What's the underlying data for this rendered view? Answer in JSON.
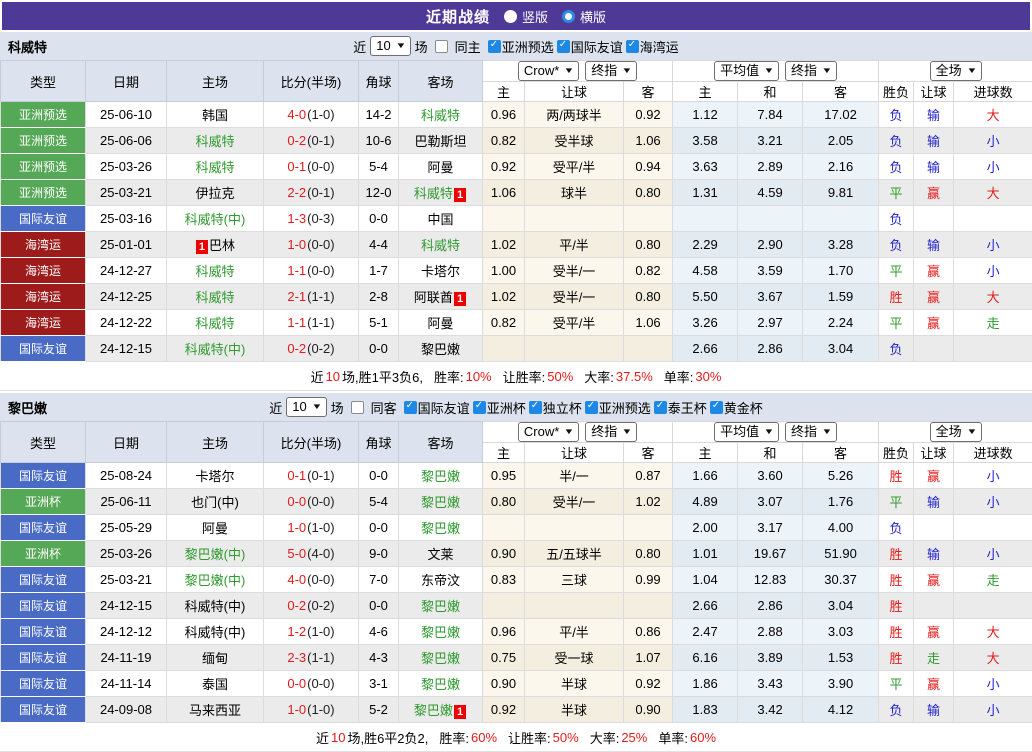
{
  "titlebar": {
    "title": "近期战绩",
    "vertical": "竖版",
    "horizontal": "横版"
  },
  "misc": {
    "badge": "1"
  },
  "table_header": {
    "cols": [
      "类型",
      "日期",
      "主场",
      "比分(半场)",
      "角球",
      "客场"
    ],
    "sub": [
      "主",
      "让球",
      "客",
      "主",
      "和",
      "客",
      "胜负",
      "让球",
      "进球数"
    ],
    "sel_odds1": "Crow*",
    "sel_odds2": "终指",
    "sel_avg1": "平均值",
    "sel_avg2": "终指",
    "sel_scope": "全场"
  },
  "sections": [
    {
      "team": "科威特",
      "filter": {
        "near": "近",
        "count": "10",
        "games": "场",
        "same": "同主",
        "leagues": [
          "亚洲预选",
          "国际友谊",
          "海湾运"
        ]
      },
      "rows": [
        {
          "t": "亚洲预选",
          "tc": "g",
          "d": "25-06-10",
          "h": "韩国",
          "hh": 0,
          "s": "4-0",
          "sh": "(1-0)",
          "c": "14-2",
          "a": "科威特",
          "ah": 1,
          "o1": "0.96",
          "hd": "两/两球半",
          "o2": "0.92",
          "m1": "1.12",
          "m2": "7.84",
          "m3": "17.02",
          "r1": "负",
          "c1": "b",
          "r2": "输",
          "c2": "b",
          "r3": "大",
          "c3": "r"
        },
        {
          "t": "亚洲预选",
          "tc": "g",
          "d": "25-06-06",
          "h": "科威特",
          "hh": 1,
          "s": "0-2",
          "sh": "(0-1)",
          "c": "10-6",
          "a": "巴勒斯坦",
          "ah": 0,
          "o1": "0.82",
          "hd": "受半球",
          "o2": "1.06",
          "m1": "3.58",
          "m2": "3.21",
          "m3": "2.05",
          "r1": "负",
          "c1": "b",
          "r2": "输",
          "c2": "b",
          "r3": "小",
          "c3": "b"
        },
        {
          "t": "亚洲预选",
          "tc": "g",
          "d": "25-03-26",
          "h": "科威特",
          "hh": 1,
          "s": "0-1",
          "sh": "(0-0)",
          "c": "5-4",
          "a": "阿曼",
          "ah": 0,
          "o1": "0.92",
          "hd": "受平/半",
          "o2": "0.94",
          "m1": "3.63",
          "m2": "2.89",
          "m3": "2.16",
          "r1": "负",
          "c1": "b",
          "r2": "输",
          "c2": "b",
          "r3": "小",
          "c3": "b"
        },
        {
          "t": "亚洲预选",
          "tc": "g",
          "d": "25-03-21",
          "h": "伊拉克",
          "hh": 0,
          "s": "2-2",
          "sh": "(0-1)",
          "c": "12-0",
          "a": "科威特",
          "ah": 1,
          "ab": "post",
          "o1": "1.06",
          "hd": "球半",
          "o2": "0.80",
          "m1": "1.31",
          "m2": "4.59",
          "m3": "9.81",
          "r1": "平",
          "c1": "g",
          "r2": "赢",
          "c2": "r",
          "r3": "大",
          "c3": "r"
        },
        {
          "t": "国际友谊",
          "tc": "b",
          "d": "25-03-16",
          "h": "科威特(中)",
          "hh": 1,
          "s": "1-3",
          "sh": "(0-3)",
          "c": "0-0",
          "a": "中国",
          "ah": 0,
          "o1": "",
          "hd": "",
          "o2": "",
          "m1": "",
          "m2": "",
          "m3": "",
          "r1": "负",
          "c1": "b",
          "r2": "",
          "r3": ""
        },
        {
          "t": "海湾运",
          "tc": "r",
          "d": "25-01-01",
          "h": "巴林",
          "hh": 0,
          "hb": "pre",
          "s": "1-0",
          "sh": "(0-0)",
          "c": "4-4",
          "a": "科威特",
          "ah": 1,
          "o1": "1.02",
          "hd": "平/半",
          "o2": "0.80",
          "m1": "2.29",
          "m2": "2.90",
          "m3": "3.28",
          "r1": "负",
          "c1": "b",
          "r2": "输",
          "c2": "b",
          "r3": "小",
          "c3": "b"
        },
        {
          "t": "海湾运",
          "tc": "r",
          "d": "24-12-27",
          "h": "科威特",
          "hh": 1,
          "s": "1-1",
          "sh": "(0-0)",
          "c": "1-7",
          "a": "卡塔尔",
          "ah": 0,
          "o1": "1.00",
          "hd": "受半/一",
          "o2": "0.82",
          "m1": "4.58",
          "m2": "3.59",
          "m3": "1.70",
          "r1": "平",
          "c1": "g",
          "r2": "赢",
          "c2": "r",
          "r3": "小",
          "c3": "b"
        },
        {
          "t": "海湾运",
          "tc": "r",
          "d": "24-12-25",
          "h": "科威特",
          "hh": 1,
          "s": "2-1",
          "sh": "(1-1)",
          "c": "2-8",
          "a": "阿联酋",
          "ah": 0,
          "ab": "post",
          "o1": "1.02",
          "hd": "受半/一",
          "o2": "0.80",
          "m1": "5.50",
          "m2": "3.67",
          "m3": "1.59",
          "r1": "胜",
          "c1": "r",
          "r2": "赢",
          "c2": "r",
          "r3": "大",
          "c3": "r"
        },
        {
          "t": "海湾运",
          "tc": "r",
          "d": "24-12-22",
          "h": "科威特",
          "hh": 1,
          "s": "1-1",
          "sh": "(1-1)",
          "c": "5-1",
          "a": "阿曼",
          "ah": 0,
          "o1": "0.82",
          "hd": "受平/半",
          "o2": "1.06",
          "m1": "3.26",
          "m2": "2.97",
          "m3": "2.24",
          "r1": "平",
          "c1": "g",
          "r2": "赢",
          "c2": "r",
          "r3": "走",
          "c3": "g"
        },
        {
          "t": "国际友谊",
          "tc": "b",
          "d": "24-12-15",
          "h": "科威特(中)",
          "hh": 1,
          "s": "0-2",
          "sh": "(0-2)",
          "c": "0-0",
          "a": "黎巴嫩",
          "ah": 0,
          "o1": "",
          "hd": "",
          "o2": "",
          "m1": "2.66",
          "m2": "2.86",
          "m3": "3.04",
          "r1": "负",
          "c1": "b",
          "r2": "",
          "r3": ""
        }
      ],
      "summary": {
        "pre": "近",
        "count": "10",
        "mid": "场,胜1平3负6, ",
        "stats": [
          [
            "胜率:",
            "10%"
          ],
          [
            "让胜率:",
            "50%"
          ],
          [
            "大率:",
            "37.5%"
          ],
          [
            "单率:",
            "30%"
          ]
        ]
      }
    },
    {
      "team": "黎巴嫩",
      "filter": {
        "near": "近",
        "count": "10",
        "games": "场",
        "same": "同客",
        "leagues": [
          "国际友谊",
          "亚洲杯",
          "独立杯",
          "亚洲预选",
          "泰王杯",
          "黄金杯"
        ]
      },
      "rows": [
        {
          "t": "国际友谊",
          "tc": "b",
          "d": "25-08-24",
          "h": "卡塔尔",
          "hh": 0,
          "s": "0-1",
          "sh": "(0-1)",
          "c": "0-0",
          "a": "黎巴嫩",
          "ah": 1,
          "o1": "0.95",
          "hd": "半/一",
          "o2": "0.87",
          "m1": "1.66",
          "m2": "3.60",
          "m3": "5.26",
          "r1": "胜",
          "c1": "r",
          "r2": "赢",
          "c2": "r",
          "r3": "小",
          "c3": "b"
        },
        {
          "t": "亚洲杯",
          "tc": "g",
          "d": "25-06-11",
          "h": "也门(中)",
          "hh": 0,
          "s": "0-0",
          "sh": "(0-0)",
          "c": "5-4",
          "a": "黎巴嫩",
          "ah": 1,
          "o1": "0.80",
          "hd": "受半/一",
          "o2": "1.02",
          "m1": "4.89",
          "m2": "3.07",
          "m3": "1.76",
          "r1": "平",
          "c1": "g",
          "r2": "输",
          "c2": "b",
          "r3": "小",
          "c3": "b"
        },
        {
          "t": "国际友谊",
          "tc": "b",
          "d": "25-05-29",
          "h": "阿曼",
          "hh": 0,
          "s": "1-0",
          "sh": "(1-0)",
          "c": "0-0",
          "a": "黎巴嫩",
          "ah": 1,
          "o1": "",
          "hd": "",
          "o2": "",
          "m1": "2.00",
          "m2": "3.17",
          "m3": "4.00",
          "r1": "负",
          "c1": "b",
          "r2": "",
          "r3": ""
        },
        {
          "t": "亚洲杯",
          "tc": "g",
          "d": "25-03-26",
          "h": "黎巴嫩(中)",
          "hh": 1,
          "s": "5-0",
          "sh": "(4-0)",
          "c": "9-0",
          "a": "文莱",
          "ah": 0,
          "o1": "0.90",
          "hd": "五/五球半",
          "o2": "0.80",
          "m1": "1.01",
          "m2": "19.67",
          "m3": "51.90",
          "r1": "胜",
          "c1": "r",
          "r2": "输",
          "c2": "b",
          "r3": "小",
          "c3": "b"
        },
        {
          "t": "国际友谊",
          "tc": "b",
          "d": "25-03-21",
          "h": "黎巴嫩(中)",
          "hh": 1,
          "s": "4-0",
          "sh": "(0-0)",
          "c": "7-0",
          "a": "东帝汶",
          "ah": 0,
          "o1": "0.83",
          "hd": "三球",
          "o2": "0.99",
          "m1": "1.04",
          "m2": "12.83",
          "m3": "30.37",
          "r1": "胜",
          "c1": "r",
          "r2": "赢",
          "c2": "r",
          "r3": "走",
          "c3": "g"
        },
        {
          "t": "国际友谊",
          "tc": "b",
          "d": "24-12-15",
          "h": "科威特(中)",
          "hh": 0,
          "s": "0-2",
          "sh": "(0-2)",
          "c": "0-0",
          "a": "黎巴嫩",
          "ah": 1,
          "o1": "",
          "hd": "",
          "o2": "",
          "m1": "2.66",
          "m2": "2.86",
          "m3": "3.04",
          "r1": "胜",
          "c1": "r",
          "r2": "",
          "r3": ""
        },
        {
          "t": "国际友谊",
          "tc": "b",
          "d": "24-12-12",
          "h": "科威特(中)",
          "hh": 0,
          "s": "1-2",
          "sh": "(1-0)",
          "c": "4-6",
          "a": "黎巴嫩",
          "ah": 1,
          "o1": "0.96",
          "hd": "平/半",
          "o2": "0.86",
          "m1": "2.47",
          "m2": "2.88",
          "m3": "3.03",
          "r1": "胜",
          "c1": "r",
          "r2": "赢",
          "c2": "r",
          "r3": "大",
          "c3": "r"
        },
        {
          "t": "国际友谊",
          "tc": "b",
          "d": "24-11-19",
          "h": "缅甸",
          "hh": 0,
          "s": "2-3",
          "sh": "(1-1)",
          "c": "4-3",
          "a": "黎巴嫩",
          "ah": 1,
          "o1": "0.75",
          "hd": "受一球",
          "o2": "1.07",
          "m1": "6.16",
          "m2": "3.89",
          "m3": "1.53",
          "r1": "胜",
          "c1": "r",
          "r2": "走",
          "c2": "g",
          "r3": "大",
          "c3": "r"
        },
        {
          "t": "国际友谊",
          "tc": "b",
          "d": "24-11-14",
          "h": "泰国",
          "hh": 0,
          "s": "0-0",
          "sh": "(0-0)",
          "c": "3-1",
          "a": "黎巴嫩",
          "ah": 1,
          "o1": "0.90",
          "hd": "半球",
          "o2": "0.92",
          "m1": "1.86",
          "m2": "3.43",
          "m3": "3.90",
          "r1": "平",
          "c1": "g",
          "r2": "赢",
          "c2": "r",
          "r3": "小",
          "c3": "b"
        },
        {
          "t": "国际友谊",
          "tc": "b",
          "d": "24-09-08",
          "h": "马来西亚",
          "hh": 0,
          "s": "1-0",
          "sh": "(1-0)",
          "c": "5-2",
          "a": "黎巴嫩",
          "ah": 1,
          "ab": "post",
          "o1": "0.92",
          "hd": "半球",
          "o2": "0.90",
          "m1": "1.83",
          "m2": "3.42",
          "m3": "4.12",
          "r1": "负",
          "c1": "b",
          "r2": "输",
          "c2": "b",
          "r3": "小",
          "c3": "b"
        }
      ],
      "summary": {
        "pre": "近",
        "count": "10",
        "mid": "场,胜6平2负2, ",
        "stats": [
          [
            "胜率:",
            "60%"
          ],
          [
            "让胜率:",
            "50%"
          ],
          [
            "大率:",
            "25%"
          ],
          [
            "单率:",
            "60%"
          ]
        ]
      }
    }
  ]
}
